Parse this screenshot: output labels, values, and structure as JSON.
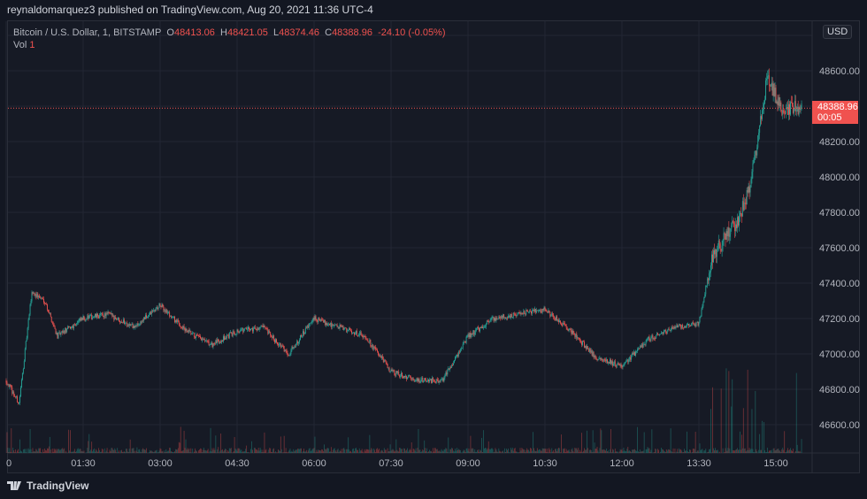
{
  "header": {
    "published": "reynaldomarquez3 published on TradingView.com, Aug 20, 2021 11:36 UTC-4"
  },
  "legend": {
    "symbol": "Bitcoin / U.S. Dollar, 1, BITSTAMP",
    "o_label": "O",
    "o": "48413.06",
    "h_label": "H",
    "h": "48421.05",
    "l_label": "L",
    "l": "48374.46",
    "c_label": "C",
    "c": "48388.96",
    "change": "-24.10 (-0.05%)",
    "vol_label": "Vol",
    "vol": "1"
  },
  "currency": "USD",
  "last_price": {
    "price": "48388.96",
    "countdown": "00:05"
  },
  "footer": {
    "brand": "TradingView"
  },
  "colors": {
    "up": "#26a69a",
    "down": "#ef5350",
    "bg": "#161a25",
    "grid": "#232734",
    "tag": "#f0524f"
  },
  "chart_data": {
    "type": "candlestick",
    "title": "Bitcoin / U.S. Dollar, 1, BITSTAMP",
    "interval_minutes": 1,
    "x_tick_labels": [
      "0",
      "01:30",
      "03:00",
      "04:30",
      "06:00",
      "07:30",
      "09:00",
      "10:30",
      "12:00",
      "13:30",
      "15:00"
    ],
    "x_tick_minutes": [
      0,
      90,
      180,
      270,
      360,
      450,
      540,
      630,
      720,
      810,
      900
    ],
    "y_tick_labels": [
      "48600.00",
      "48200.00",
      "48000.00",
      "47800.00",
      "47600.00",
      "47400.00",
      "47200.00",
      "47000.00",
      "46800.00",
      "46600.00"
    ],
    "y_ticks": [
      48600,
      48200,
      48000,
      47800,
      47600,
      47400,
      47200,
      47000,
      46800,
      46600
    ],
    "ylim": [
      46420,
      48800
    ],
    "price_path_minutes": [
      0,
      15,
      30,
      45,
      60,
      90,
      120,
      150,
      180,
      210,
      240,
      270,
      300,
      330,
      360,
      390,
      420,
      450,
      480,
      510,
      540,
      570,
      600,
      630,
      660,
      690,
      720,
      750,
      780,
      810,
      825,
      840,
      855,
      870,
      885,
      890,
      900,
      910,
      920,
      930
    ],
    "price_path": [
      46850,
      46720,
      47350,
      47300,
      47100,
      47200,
      47225,
      47150,
      47275,
      47130,
      47050,
      47130,
      47150,
      47000,
      47200,
      47150,
      47100,
      46900,
      46850,
      46850,
      47100,
      47200,
      47225,
      47250,
      47130,
      46980,
      46930,
      47080,
      47150,
      47170,
      47550,
      47650,
      47750,
      47950,
      48400,
      48575,
      48450,
      48350,
      48400,
      48389
    ],
    "last_close": 48388.96
  }
}
